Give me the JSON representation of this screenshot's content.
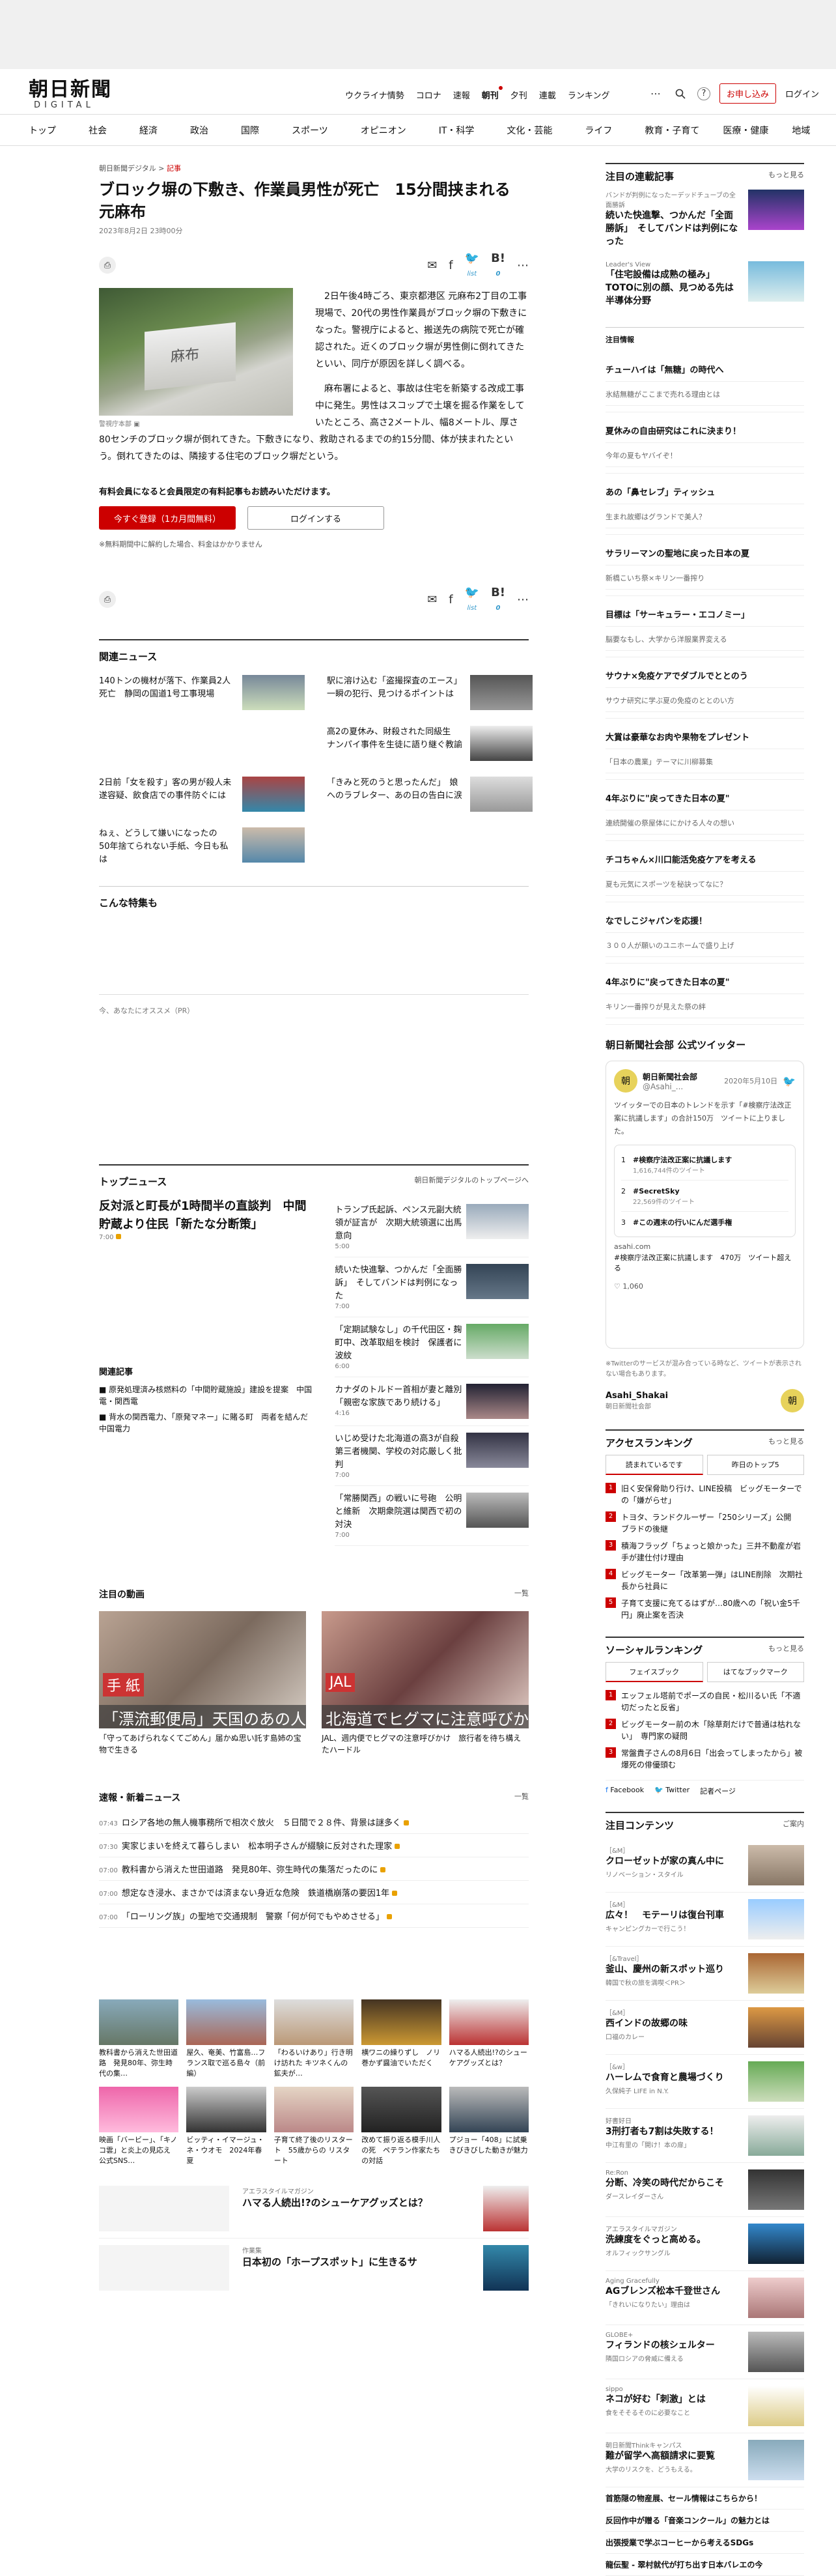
{
  "header": {
    "logo_main": "朝日新聞",
    "logo_sub": "DIGITAL",
    "nav": [
      "ウクライナ情勢",
      "コロナ",
      "速報",
      "朝刊",
      "夕刊",
      "連載",
      "ランキング"
    ],
    "subscribe": "お申し込み",
    "login": "ログイン",
    "more_icon": "dots-icon",
    "search_icon": "search-icon",
    "help": "?"
  },
  "gnav": [
    "トップ",
    "社会",
    "経済",
    "政治",
    "国際",
    "スポーツ",
    "オピニオン",
    "IT・科学",
    "文化・芸能",
    "ライフ",
    "教育・子育て",
    "医療・健康",
    "地域"
  ],
  "article": {
    "crumb1": "朝日新聞デジタル",
    "crumb_sep": ">",
    "crumb2": "記事",
    "title": "ブロック塀の下敷き、作業員男性が死亡　15分間挟まれる　元麻布",
    "date": "2023年8月2日 23時00分",
    "list_label": "list",
    "count": "0",
    "photo_text": "麻布",
    "caption": "警視庁本部",
    "p1": "2日午後4時ごろ、東京都港区 元麻布2丁目の工事現場で、20代の男性作業員がブロック塀の下敷きになった。警視庁によると、搬送先の病院で死亡が確認された。近くのブロック塀が男性側に倒れてきたといい、同庁が原因を詳しく調べる。",
    "p2": "麻布署によると、事故は住宅を新築する改成工事中に発生。男性はスコップで土壌を掘る作業をしていたところ、高さ2メートル、幅8メートル、厚さ80センチのブロック塀が倒れてきた。下敷きになり、救助されるまでの約15分間、体が挟まれたという。倒れてきたのは、隣接する住宅のブロック塀だという。",
    "member_msg": "有料会員になると会員限定の有料記事もお読みいただけます。",
    "btn_register": "今すぐ登録（1カ月間無料）",
    "btn_login": "ログインする",
    "note": "※無料期間中に解約した場合、料金はかかりません"
  },
  "related": {
    "title": "関連ニュース",
    "items": [
      "140トンの機材が落下、作業員2人死亡　静岡の国道1号工事現場",
      "駅に溶け込む「盗撮探査のエース」　一瞬の犯行、見つけるポイントは",
      "",
      "高2の夏休み、財殺された同級生　ナンパイ事件を生徒に語り継ぐ教諭",
      "2日前「女を殺す」客の男が殺人未遂容疑、飲食店での事件防ぐには",
      "「きみと死のうと思ったんだ」　娘へのラブレター、あの日の告白に涙",
      "ねぇ、どうして嫌いになったの　50年捨てられない手紙、今日も私は",
      ""
    ]
  },
  "features": {
    "title": "こんな特集も",
    "recommend": "今、あなたにオススメ（PR）"
  },
  "topnews": {
    "title": "トップニュース",
    "more": "朝日新聞デジタルのトップページへ",
    "lead": "反対派と町長が1時間半の直談判　中間貯蔵より住民「新たな分断策」",
    "lead_time": "7:00",
    "rel_title": "関連記事",
    "rel": [
      "原発処理済み核燃料の「中間貯蔵施設」建設を提案　中国電・関西電",
      "背水の関西電力、「原発マネー」に賭る町　両者を結んだ中国電力"
    ],
    "items": [
      {
        "t": "トランプ氏起訴、ペンス元副大統領が証言が　次期大統領選に出馬意向",
        "tm": "5:00"
      },
      {
        "t": "続いた快進撃、つかんだ「全面勝訴」　そしてバンドは判例になった",
        "tm": "7:00"
      },
      {
        "t": "「定期試験なし」の千代田区・麹町中、改革取組を検討　保護者に波紋",
        "tm": "6:00"
      },
      {
        "t": "カナダのトルドー首相が妻と離別　「親密な家族であり続ける」",
        "tm": "4:16"
      },
      {
        "t": "いじめ受けた北海道の高3が自殺　第三者機関、学校の対応厳しく批判",
        "tm": "7:00"
      },
      {
        "t": "「常勝関西」の戦いに号砲　公明と維新　次期衆院選は関西で初の対決",
        "tm": "7:00"
      }
    ]
  },
  "videos": {
    "title": "注目の動画",
    "more": "一覧",
    "items": [
      {
        "tag": "手 紙",
        "bar": "「漂流郵便局」天国のあの人へ…",
        "t": "「守ってあげられなくてごめん」届かぬ思い託す島姉の宝物で生きる"
      },
      {
        "tag": "JAL",
        "bar": "北海道でヒグマに注意呼びかけ",
        "t": "JAL、週内便でヒグマの注意呼びかけ　旅行者を待ち構えたハードル"
      }
    ]
  },
  "breaking": {
    "title": "速報・新着ニュース",
    "more": "一覧",
    "items": [
      {
        "tm": "07:43",
        "t": "ロシア各地の無人機事務所で相次ぐ放火　５日間で２８件、背景は謎多く"
      },
      {
        "tm": "07:30",
        "t": "実家じまいを終えて暮らしまい　松本明子さんが綴験に反対された理家"
      },
      {
        "tm": "07:00",
        "t": "教科書から消えた世田道路　発見80年、弥生時代の集落だったのに"
      },
      {
        "tm": "07:00",
        "t": "想定なき浸水、まさかでは済まない身近な危険　鉄道橋崩落の要因1年"
      },
      {
        "tm": "07:00",
        "t": "「ローリング族」の聖地で交通規制　警察「何が何でもやめさせる」"
      }
    ]
  },
  "grid": [
    "教科書から消えた世田道路　発見80年、弥生時代の集…",
    "屋久、奄美、竹富島…フランス取で巡る島々（前編）",
    "「わるいけあり」行き明け訪れた キツネくんの鉱夫が…",
    "横ワニの繰りずし　ノリ巻かず醤油でいただく",
    "ハマる人続出!?のシューケアグッズとは？",
    "映画「バービー」、「キノコ雲」と炎上の見応え　公式SNS…",
    "ビッティ・イマージュ・ネ・ウオモ　2024年春夏",
    "子育て終了後のリスタート　55歳からの リスタート",
    "改めて振り返る模手川人の死　ペテラン作家たちの対話",
    "プジョー「408」に試乗　きびきびした動きが魅力"
  ],
  "promos": [
    {
      "k": "アエラスタイルマガジン",
      "t": "ハマる人続出!?のシューケアグッズとは？"
    },
    {
      "k": "作業集",
      "t": "日本初の「ホープスポット」に生きるサ"
    }
  ],
  "side": {
    "serial_title": "注目の連載記事",
    "more": "もっと見る",
    "serial": [
      {
        "k": "バンドが判例になったーデッドチューブの全面勝訴",
        "t": "続いた快進撃、つかんだ「全面勝訴」　そしてバンドは判例になった"
      },
      {
        "k": "Leader's View",
        "t": "「住宅設備は成熟の極み」TOTOに別の顔、見つめる先は半導体分野"
      }
    ],
    "attn_title": "注目情報",
    "attn": [
      {
        "t": "チューハイは「無糖」の時代へ",
        "s": "氷結無糖がここまで売れる理由とは"
      },
      {
        "t": "夏休みの自由研究はこれに決まり！",
        "s": "今年の夏もヤバイぞ！"
      },
      {
        "t": "あの「鼻セレブ」ティッシュ",
        "s": "生まれ故郷はグランドで美人？"
      },
      {
        "t": "サラリーマンの聖地に戻った日本の夏",
        "s": "新橋こいち祭×キリン一番搾り"
      },
      {
        "t": "目標は「サーキュラー・エコノミー」",
        "s": "脳要なもし、大学から洋服業界変える"
      },
      {
        "t": "サウナ×免疫ケアでダブルでととのう",
        "s": "サウナ研究に学ぶ夏の免疫のととのい方"
      },
      {
        "t": "大賞は豪華なお肉や果物をプレゼント",
        "s": "「日本の農業」テーマに川柳募集"
      },
      {
        "t": "4年ぶりに\"戻ってきた日本の夏\"",
        "s": "連続開催の祭屋体ににかける人々の想い"
      },
      {
        "t": "チコちゃん×川口能活免疫ケアを考える",
        "s": "夏も元気にスポーツを秘訣ってなに？"
      },
      {
        "t": "なでしこジャパンを応援！",
        "s": "３００人が願いのユニホームで盛り上げ"
      },
      {
        "t": "4年ぶりに\"戻ってきた日本の夏\"",
        "s": "キリン一番搾りが見えた祭の絆"
      }
    ],
    "twitter_title": "朝日新聞社会部 公式ツイッター",
    "tw_name": "朝日新聞社会部",
    "tw_handle": "@Asahi_...",
    "tw_date": "2020年5月10日",
    "tw_body": "ツイッターでの日本のトレンドを示す「#検察庁法改正案に抗議します」の合計150万　ツイートに上りました。",
    "tw_trends": [
      {
        "n": "1",
        "t": "#検察庁法改正案に抗議します",
        "c": "1,616,744件のツイート"
      },
      {
        "n": "2",
        "t": "#SecretSky",
        "c": "22,569件のツイート"
      },
      {
        "n": "3",
        "t": "#この週末の行いにんだ選手権",
        "c": ""
      }
    ],
    "tw_site": "asahi.com",
    "tw_link": "#検察庁法改正案に抗議します　470万　ツイート超える",
    "tw_likes": "1,060",
    "tw_note": "※Twitterのサービスが混み合っている時など、ツイートが表示されない場合もあります。",
    "tw_account": "Asahi_Shakai",
    "tw_account_sub": "朝日新聞社会部",
    "rank_title": "アクセスランキング",
    "rank_tab1": "読まれているです",
    "rank_tab2": "昨日のトップ5",
    "rank": [
      "旧く安保脅助り行け、LINE投稿　ビッグモーターでの「嫌がらせ」",
      "トヨタ、ランドクルーザー「250シリーズ」公開　ブラドの後継",
      "積海フラッグ「ちょっと娘かった」三井不動産が岩手が建仕付け理由",
      "ビッグモーター「改革第一弾」はLINE削除　次期社長から社員に",
      "子育て支援に充てるはずが…80歳への「祝い金5千円」廃止案を否決"
    ],
    "social_title": "ソーシャルランキング",
    "social_tab1": "フェイスブック",
    "social_tab2": "はてなブックマーク",
    "social": [
      "エッフェル塔前でポーズの自民・松川るい氏「不適切だったと反省」",
      "ビッグモーター前の木「除草剤だけで普通は枯れない」　専門家の疑問",
      "常盤貴子さんの8月6日「出会ってしまったから」被爆死の俳優頭む"
    ],
    "social_fb": "Facebook",
    "social_tw": "Twitter",
    "social_rec": "記者ページ",
    "contents_title": "注目コンテンツ",
    "contents_more": "ご案内",
    "contents": [
      {
        "k": "［&M］",
        "t": "クローゼットが家の真ん中に",
        "s": "リノベーション・スタイル"
      },
      {
        "k": "［&M］",
        "t": "広々！　モテーリは復台刊車",
        "s": "キャンピングカーで行こう！"
      },
      {
        "k": "［&Travel］",
        "t": "釜山、慶州の新スポット巡り",
        "s": "韓国で秋の旅を満喫＜PR＞"
      },
      {
        "k": "［&M］",
        "t": "西インドの故郷の味",
        "s": "口福のカレー"
      },
      {
        "k": "［&w］",
        "t": "ハーレムで食育と農場づくり",
        "s": "久保純子 LIFE in N.Y."
      },
      {
        "k": "好書好日",
        "t": "3刑打者も7割は失敗する！",
        "s": "中江有里の「開け！本の扉」"
      },
      {
        "k": "Re:Ron",
        "t": "分断、冷笑の時代だからこそ",
        "s": "ダースレイダーさん"
      },
      {
        "k": "アエラスタイルマガジン",
        "t": "洗練度をぐっと高める。",
        "s": "オルフィックサングル"
      },
      {
        "k": "Aging Gracefully",
        "t": "AGブレンズ松本千登世さん",
        "s": "「きれいになりたい」理由は"
      },
      {
        "k": "GLOBE+",
        "t": "フィランドの核シェルター",
        "s": "隣国ロシアの脅威に備える"
      },
      {
        "k": "sippo",
        "t": "ネコが好む「刺激」とは",
        "s": "食をそそるそのに必要なこと"
      },
      {
        "k": "朝日新聞Thinkキャンパス",
        "t": "難が留学へ高額請求に要覧",
        "s": "大学のリスクを、どうもえる。"
      }
    ],
    "tail": [
      "首筋隠の物産展、セール情報はこちらから！",
      "反回作中が贈る「音楽コンクール」の魅力とは",
      "出張授業で学ぶコーヒーから考えるSDGs",
      "龍伝聖 - 翠村就代が打ち出す日本バレエの今"
    ]
  }
}
